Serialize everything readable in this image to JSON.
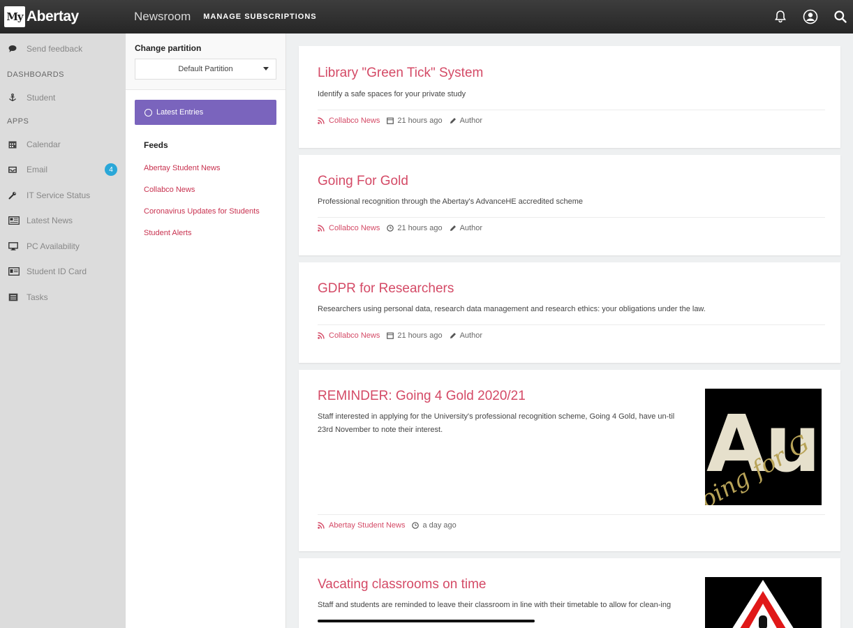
{
  "header": {
    "logo_badge": "My",
    "logo_text": "Abertay",
    "app_title": "Newsroom",
    "manage_label": "MANAGE SUBSCRIPTIONS",
    "notification_count_icon": "bell-icon",
    "account_icon": "user-circle-icon",
    "search_icon": "search-icon"
  },
  "sidebar": {
    "feedback": "Send feedback",
    "dashboards_head": "DASHBOARDS",
    "student": "Student",
    "apps_head": "APPS",
    "items": [
      {
        "label": "Calendar",
        "icon": "calendar-icon"
      },
      {
        "label": "Email",
        "icon": "inbox-icon",
        "badge": "4"
      },
      {
        "label": "IT Service Status",
        "icon": "wrench-icon"
      },
      {
        "label": "Latest News",
        "icon": "newspaper-icon"
      },
      {
        "label": "PC Availability",
        "icon": "monitor-icon"
      },
      {
        "label": "Student ID Card",
        "icon": "id-card-icon"
      },
      {
        "label": "Tasks",
        "icon": "tasks-icon"
      }
    ]
  },
  "panel": {
    "partition_label": "Change partition",
    "partition_value": "Default Partition",
    "latest_entries": "Latest Entries",
    "feeds_title": "Feeds",
    "feeds": [
      "Abertay Student News",
      "Collabco News",
      "Coronavirus Updates for Students",
      "Student Alerts"
    ]
  },
  "articles": [
    {
      "title": "Library \"Green Tick\" System",
      "summary": "Identify a safe spaces for your private study",
      "source": "Collabco News",
      "time": "21 hours ago",
      "author": "Author"
    },
    {
      "title": "Going For Gold",
      "summary": "Professional recognition through the Abertay's AdvanceHE accredited scheme",
      "source": "Collabco News",
      "time": "21 hours ago",
      "author": "Author"
    },
    {
      "title": "GDPR for Researchers",
      "summary": "Researchers using personal data, research data management and research ethics: your obligations under the law.",
      "source": "Collabco News",
      "time": "21 hours ago",
      "author": "Author"
    },
    {
      "title": "REMINDER: Going 4 Gold 2020/21",
      "summary": "Staff interested in applying for the University's professional recognition scheme, Going 4 Gold, have un-til 23rd November to note their interest.",
      "source": "Abertay Student News",
      "time": "a day ago"
    },
    {
      "title": "Vacating classrooms on time",
      "summary": "Staff and students are reminded to leave their classroom in line with their timetable to allow for clean-ing"
    }
  ],
  "colors": {
    "accent": "#d44a66",
    "button": "#7a64bd",
    "topbar": "#2f2f2f",
    "badge": "#2aa7d8"
  }
}
